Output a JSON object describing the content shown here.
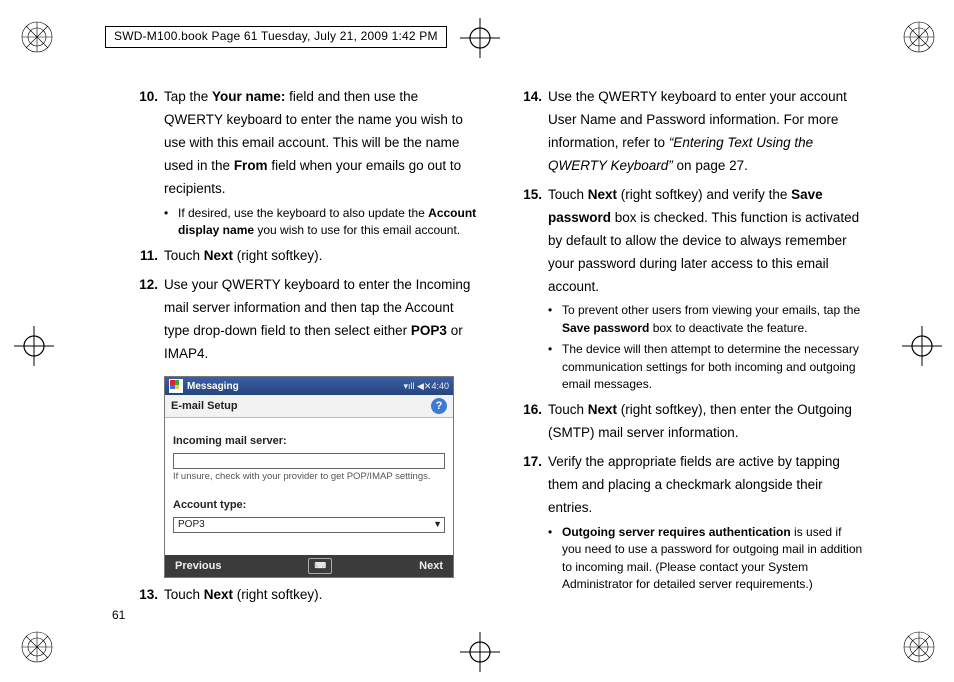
{
  "header": "SWD-M100.book  Page 61  Tuesday, July 21, 2009  1:42 PM",
  "page_number": "61",
  "left": {
    "step10": {
      "num": "10.",
      "t1": "Tap the ",
      "b1": "Your name:",
      "t2": " field and then use the QWERTY keyboard to enter the name you wish to use with this email account. This will be the name used in the ",
      "b2": "From",
      "t3": " field when your emails go out to recipients.",
      "bullet": {
        "t1": "If desired, use the keyboard to also update the ",
        "b1": "Account display name",
        "t2": " you wish to use for this email account."
      }
    },
    "step11": {
      "num": "11.",
      "t1": "Touch ",
      "b1": "Next",
      "t2": " (right softkey)."
    },
    "step12": {
      "num": "12.",
      "t1": "Use your QWERTY keyboard to enter the Incoming mail server information and then tap the Account type drop-down field to then select either ",
      "b1": "POP3",
      "t2": " or IMAP4."
    },
    "step13": {
      "num": "13.",
      "t1": "Touch ",
      "b1": "Next",
      "t2": " (right softkey)."
    }
  },
  "phone": {
    "top_title": "Messaging",
    "time": "4:40",
    "sub_title": "E-mail Setup",
    "incoming_label": "Incoming mail server:",
    "hint": "If unsure, check with your provider to get POP/IMAP settings.",
    "account_type_label": "Account type:",
    "account_type_value": "POP3",
    "bot_prev": "Previous",
    "bot_next": "Next"
  },
  "right": {
    "step14": {
      "num": "14.",
      "t1": "Use the QWERTY keyboard to enter your account User Name and Password information. For more information, refer to ",
      "i1": "“Entering Text Using the QWERTY Keyboard”",
      "t2": "  on page 27."
    },
    "step15": {
      "num": "15.",
      "t1": "Touch ",
      "b1": "Next",
      "t2": " (right softkey) and verify the ",
      "b2": "Save password",
      "t3": " box is checked. This function is activated by default to allow the device to always remember your password during later access to this email account.",
      "bullet1": {
        "t1": "To prevent other users from viewing your emails, tap the ",
        "b1": "Save password",
        "t2": " box to deactivate the feature."
      },
      "bullet2": {
        "t1": "The device will then attempt to determine the necessary communication settings for both incoming and outgoing email messages."
      }
    },
    "step16": {
      "num": "16.",
      "t1": "Touch ",
      "b1": "Next",
      "t2": " (right softkey), then enter the Outgoing (SMTP) mail server information."
    },
    "step17": {
      "num": "17.",
      "t1": "Verify the appropriate fields are active by tapping them and placing a checkmark alongside their entries.",
      "bullet1": {
        "b1": "Outgoing server requires authentication",
        "t1": " is used if you need to use a password for outgoing mail in addition to incoming mail. (Please contact your System Administrator for detailed server requirements.)"
      }
    }
  }
}
